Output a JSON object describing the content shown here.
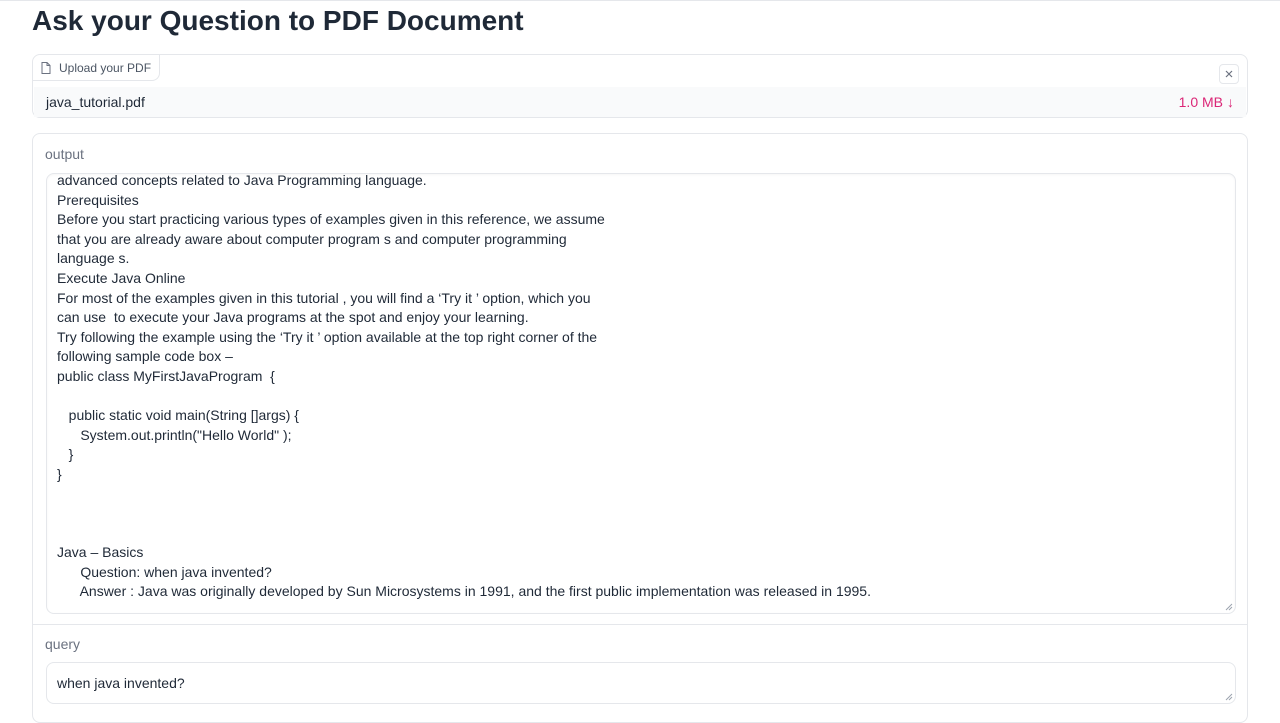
{
  "page": {
    "title": "Ask your Question to PDF Document"
  },
  "upload": {
    "label": "Upload your PDF",
    "file_name": "java_tutorial.pdf",
    "file_size": "1.0 MB",
    "download_icon": "↓",
    "clear_icon": "×"
  },
  "output": {
    "label": "output",
    "text": "advanced concepts related to Java Programming language.\nPrerequisites\nBefore you start practicing various types of examples given in this reference, we assume\nthat you are already aware about computer program s and computer programming\nlanguage s.\nExecute Java Online\nFor most of the examples given in this tutorial , you will find a ‘Try it ’ option, which you\ncan use  to execute your Java programs at the spot and enjoy your learning.\nTry following the example using the ‘Try it ’ option available at the top right corner of the\nfollowing sample code box –\npublic class MyFirstJavaProgram  {\n\n   public static void main(String []args) {\n      System.out.println(\"Hello World\" );\n   }\n}\n\n\n\nJava – Basics\n      Question: when java invented?\n      Answer : Java was originally developed by Sun Microsystems in 1991, and the first public implementation was released in 1995."
  },
  "query": {
    "label": "query",
    "value": "when java invented?"
  },
  "colors": {
    "accent": "#db2777",
    "border": "#e5e7eb",
    "muted": "#6b7280"
  }
}
